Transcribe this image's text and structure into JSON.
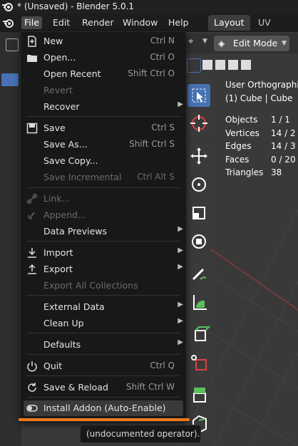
{
  "window": {
    "title": "* (Unsaved) - Blender 5.0.1"
  },
  "menubar": {
    "items": [
      "File",
      "Edit",
      "Render",
      "Window",
      "Help"
    ],
    "workspace_tabs": [
      "Layout",
      "UV check"
    ]
  },
  "viewport": {
    "mode": "Edit Mode",
    "view_title": "User Orthographic",
    "object_line": "(1) Cube | Cube",
    "stats": [
      {
        "label": "Objects",
        "value": "1 / 1"
      },
      {
        "label": "Vertices",
        "value": "14 / 2"
      },
      {
        "label": "Edges",
        "value": "14 / 3"
      },
      {
        "label": "Faces",
        "value": "0 / 20"
      },
      {
        "label": "Triangles",
        "value": "38"
      }
    ]
  },
  "file_menu": {
    "new": {
      "label": "New",
      "shortcut": "Ctrl N"
    },
    "open": {
      "label": "Open...",
      "shortcut": "Ctrl O"
    },
    "open_recent": {
      "label": "Open Recent",
      "shortcut": "Shift Ctrl O"
    },
    "revert": {
      "label": "Revert"
    },
    "recover": {
      "label": "Recover"
    },
    "save": {
      "label": "Save",
      "shortcut": "Ctrl S"
    },
    "save_as": {
      "label": "Save As...",
      "shortcut": "Shift Ctrl S"
    },
    "save_copy": {
      "label": "Save Copy..."
    },
    "save_incremental": {
      "label": "Save Incremental",
      "shortcut": "Ctrl Alt S"
    },
    "link": {
      "label": "Link..."
    },
    "append": {
      "label": "Append..."
    },
    "data_previews": {
      "label": "Data Previews"
    },
    "import": {
      "label": "Import"
    },
    "export": {
      "label": "Export"
    },
    "export_all": {
      "label": "Export All Collections"
    },
    "external_data": {
      "label": "External Data"
    },
    "clean_up": {
      "label": "Clean Up"
    },
    "defaults": {
      "label": "Defaults"
    },
    "quit": {
      "label": "Quit",
      "shortcut": "Ctrl Q"
    },
    "save_reload": {
      "label": "Save & Reload",
      "shortcut": "Shift Ctrl W"
    },
    "install_addon": {
      "label": "Install Addon (Auto-Enable)"
    }
  },
  "tooltip": {
    "text": "(undocumented operator)."
  },
  "colors": {
    "accent": "#4772b3",
    "highlight_bar": "#f07a1c"
  }
}
